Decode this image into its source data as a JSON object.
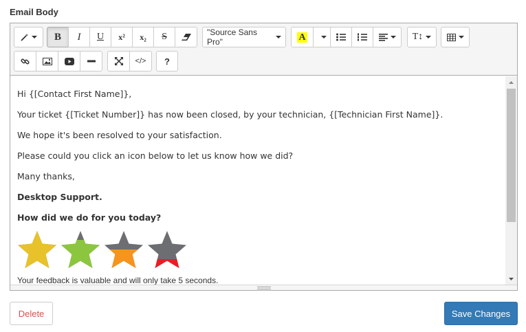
{
  "field": {
    "label": "Email Body"
  },
  "toolbar": {
    "font_name": "\"Source Sans Pro\"",
    "superscript": "x²",
    "subscript": "x₂",
    "help": "?"
  },
  "body": {
    "lines": [
      "Hi {[Contact First Name]},",
      "Your ticket {[Ticket Number]} has now been closed, by your technician, {[Technician First Name]}.",
      "We hope it's been resolved to your satisfaction.",
      "Please could you click an icon below to let us know how we did?",
      "Many thanks,"
    ],
    "signature": "Desktop Support.",
    "question": "How did we do for you today?",
    "feedback_note": "Your feedback is valuable and will only take 5 seconds.",
    "rating_stars": [
      {
        "icon": "star-icon",
        "fill_color": "#e8c22a",
        "fill_fraction": 1.0
      },
      {
        "icon": "star-icon",
        "fill_color": "#8cc63f",
        "fill_fraction": 0.75
      },
      {
        "icon": "star-icon",
        "fill_color": "#f7941d",
        "fill_fraction": 0.5
      },
      {
        "icon": "star-icon",
        "fill_color": "#ed1c24",
        "fill_fraction": 0.25
      }
    ],
    "star_base_color": "#6d6e71"
  },
  "actions": {
    "delete_label": "Delete",
    "save_label": "Save Changes"
  },
  "colors": {
    "primary": "#337ab7",
    "danger": "#d9534f",
    "highlight": "#ffff00"
  }
}
